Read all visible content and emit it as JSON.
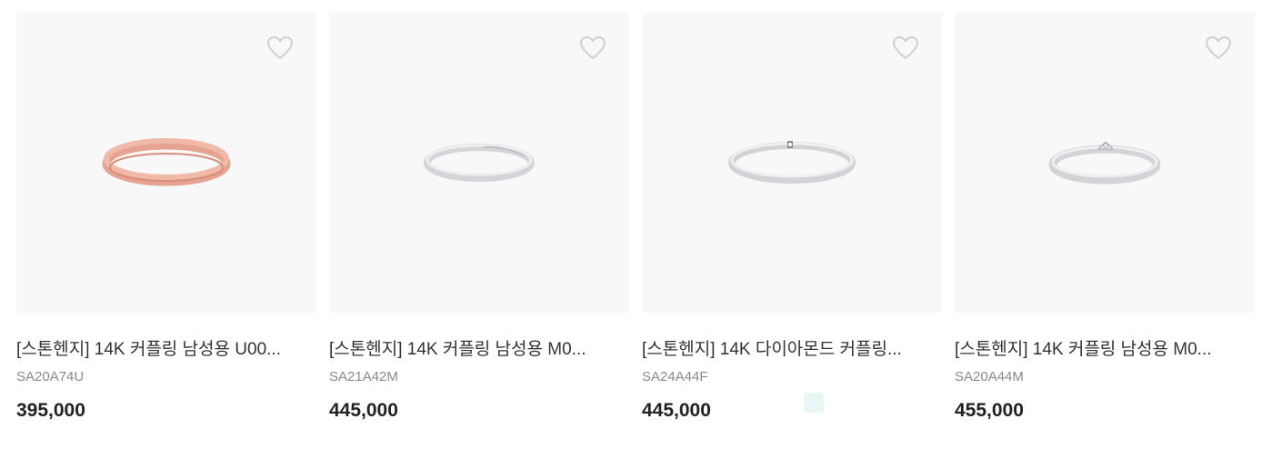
{
  "products": [
    {
      "title": "[스톤헨지] 14K 커플링 남성용 U00...",
      "code": "SA20A74U",
      "price": "395,000",
      "ring_color": "rose-gold",
      "wishlist_icon": "heart-outline-icon"
    },
    {
      "title": "[스톤헨지] 14K 커플링 남성용 M0...",
      "code": "SA21A42M",
      "price": "445,000",
      "ring_color": "white-gold",
      "wishlist_icon": "heart-outline-icon"
    },
    {
      "title": "[스톤헨지] 14K 다이아몬드 커플링...",
      "code": "SA24A44F",
      "price": "445,000",
      "ring_color": "white-gold",
      "wishlist_icon": "heart-outline-icon"
    },
    {
      "title": "[스톤헨지] 14K 커플링 남성용 M0...",
      "code": "SA20A44M",
      "price": "455,000",
      "ring_color": "white-gold",
      "wishlist_icon": "heart-outline-icon"
    }
  ],
  "colors": {
    "thumb_bg": "#f8f8f8",
    "rose_gold": "#e9a08e",
    "white_gold": "#d9dadc",
    "heart_stroke": "#cfcfcf"
  }
}
